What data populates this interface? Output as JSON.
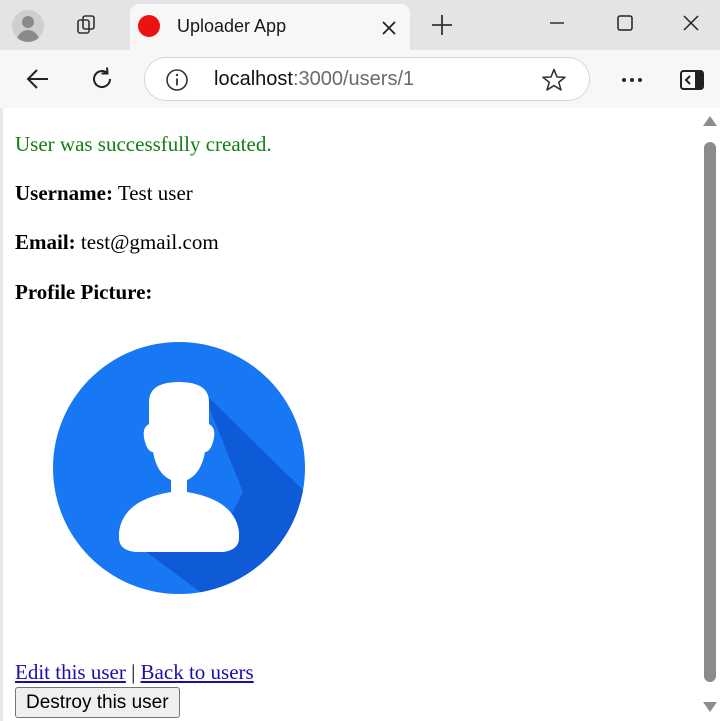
{
  "browser": {
    "tab": {
      "title": "Uploader App"
    },
    "address": {
      "host": "localhost",
      "path": ":3000/users/1"
    }
  },
  "page": {
    "notice": "User was successfully created.",
    "username": {
      "label": "Username:",
      "value": "Test user"
    },
    "email": {
      "label": "Email:",
      "value": "test@gmail.com"
    },
    "profile_picture": {
      "label": "Profile Picture:",
      "icon": "user-avatar-icon"
    },
    "links": {
      "edit": "Edit this user",
      "separator": "|",
      "back": "Back to users"
    },
    "destroy_button": "Destroy this user"
  },
  "colors": {
    "notice": "#118011",
    "link": "#1a0dab",
    "favicon": "#ee1111",
    "avatar_circle": "#1877f2",
    "avatar_shadow": "#0f5ad6"
  }
}
